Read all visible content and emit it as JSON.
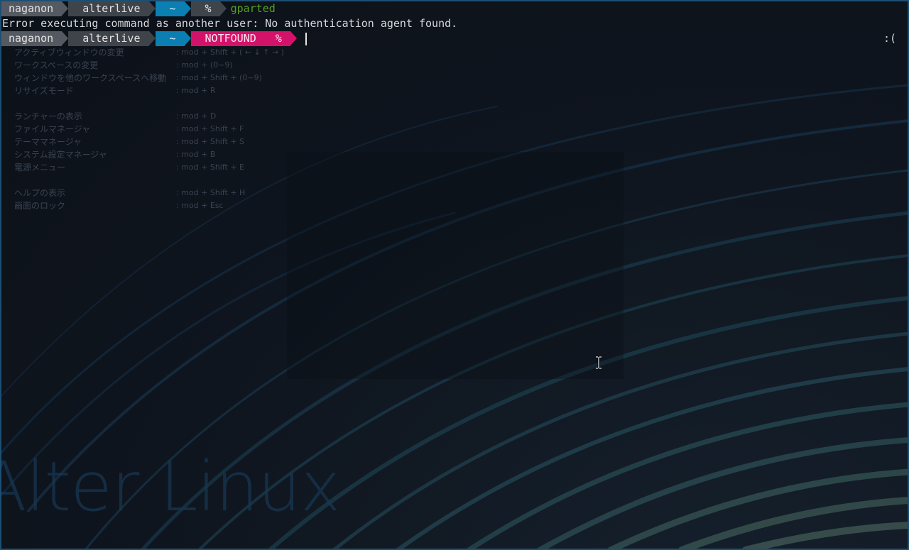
{
  "terminal": {
    "line1": {
      "user": "naganon",
      "host": "alterlive",
      "dir": "~",
      "symbol": "%",
      "command": "gparted"
    },
    "error_message": "Error executing command as another user: No authentication agent found.",
    "line3": {
      "user": "naganon",
      "host": "alterlive",
      "dir": "~",
      "status": "NOTFOUND",
      "symbol": "%",
      "right_status": ":("
    }
  },
  "shortcuts": [
    {
      "label": "アクティブウィンドウの変更",
      "keys": ": mod + Shift + ( ← ↓ ↑ → )"
    },
    {
      "label": "ワークスペースの変更",
      "keys": ": mod + (0~9)"
    },
    {
      "label": "ウィンドウを他のワークスペースへ移動",
      "keys": ": mod + Shift + (0~9)"
    },
    {
      "label": "リサイズモード",
      "keys": ": mod + R"
    },
    {
      "label": "ランチャーの表示",
      "keys": ": mod + D"
    },
    {
      "label": "ファイルマネージャ",
      "keys": ": mod + Shift + F"
    },
    {
      "label": "テーママネージャ",
      "keys": ": mod + Shift + S"
    },
    {
      "label": "システム設定マネージャ",
      "keys": ": mod + B"
    },
    {
      "label": "電源メニュー",
      "keys": ": mod + Shift + E"
    },
    {
      "label": "ヘルプの表示",
      "keys": ": mod + Shift + H"
    },
    {
      "label": "画面のロック",
      "keys": ": mod + Esc"
    }
  ],
  "wallpaper": {
    "brand_text": "Alter Linux"
  },
  "colors": {
    "prompt_user_bg": "#555a62",
    "prompt_host_bg": "#3f444b",
    "prompt_dir_bg": "#0b7fb1",
    "prompt_status_bg": "#d3136a",
    "command_color": "#56a01e",
    "window_border": "#1d4f73"
  }
}
